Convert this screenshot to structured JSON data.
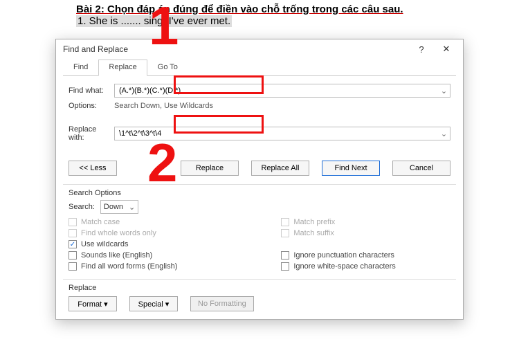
{
  "document": {
    "heading": "Bài 2: Chọn đáp án đúng để điền vào chỗ trống trong các câu sau.",
    "line1_a": "1. She is ....... sing",
    "line1_b": " I've ever met."
  },
  "dialog": {
    "title": "Find and Replace",
    "help": "?",
    "close": "✕",
    "tabs": {
      "find": "Find",
      "replace": "Replace",
      "goto": "Go To"
    },
    "find_label": "Find what:",
    "find_value": "(A.*)(B.*)(C.*)(D.*)",
    "options_label": "Options:",
    "options_value": "Search Down, Use Wildcards",
    "replace_label": "Replace with:",
    "replace_value": "\\1^t\\2^t\\3^t\\4",
    "buttons": {
      "less": "<< Less",
      "replace": "Replace",
      "replace_all": "Replace All",
      "find_next": "Find Next",
      "cancel": "Cancel"
    },
    "search_options_title": "Search Options",
    "search_label": "Search:",
    "search_dir": "Down",
    "checks_left": {
      "match_case": "Match case",
      "whole_words": "Find whole words only",
      "wildcards": "Use wildcards",
      "sounds_like": "Sounds like (English)",
      "word_forms": "Find all word forms (English)"
    },
    "checks_right": {
      "match_prefix": "Match prefix",
      "match_suffix": "Match suffix",
      "ignore_punct": "Ignore punctuation characters",
      "ignore_space": "Ignore white-space characters"
    },
    "replace_section": "Replace",
    "format_btn": "Format ▾",
    "special_btn": "Special ▾",
    "noformat_btn": "No Formatting"
  },
  "annotations": {
    "one": "1",
    "two": "2"
  }
}
